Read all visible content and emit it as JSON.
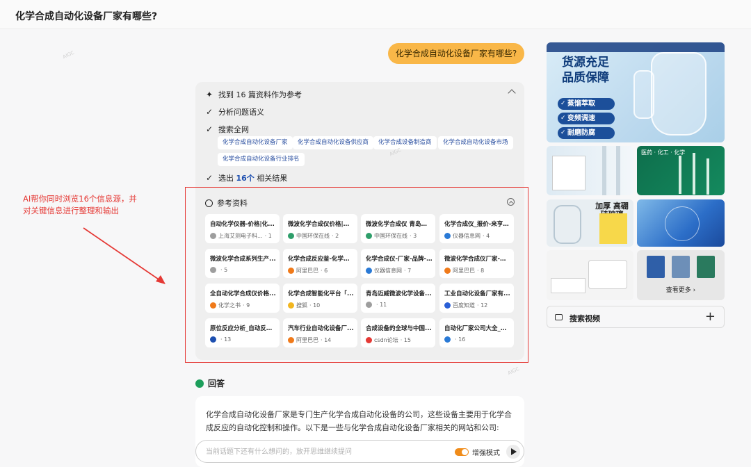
{
  "header": {
    "title": "化学合成自动化设备厂家有哪些?"
  },
  "query": {
    "text": "化学合成自动化设备厂家有哪些?"
  },
  "process": {
    "found": "找到 16 篇资料作为参考",
    "steps": [
      "分析问题语义",
      "搜索全网"
    ],
    "chips": [
      "化学合成自动化设备厂家",
      "化学合成自动化设备供应商",
      "化学合成设备制造商",
      "化学合成自动化设备市场",
      "化学合成自动化设备行业排名"
    ],
    "select_prefix": "选出",
    "select_count": "16个",
    "select_suffix": "相关结果"
  },
  "references": {
    "title": "参考资料",
    "cards": [
      {
        "title": "自动化学仪器-价格|化...",
        "source": "上海艾测电子科...",
        "num": "· 1",
        "color": "#9e9e9e"
      },
      {
        "title": "微波化学合成仪价格|报...",
        "source": "中国环保在线",
        "num": "· 2",
        "color": "#2e9e6a"
      },
      {
        "title": "微波化学合成仪 青岛东...",
        "source": "中国环保在线",
        "num": "· 3",
        "color": "#2e9e6a"
      },
      {
        "title": "化学合成仪_报价-来亨科...",
        "source": "仪器信息网",
        "num": "· 4",
        "color": "#2a7ad6"
      },
      {
        "title": "微波化学合成系列生产...",
        "source": "",
        "num": "· 5",
        "color": "#9e9e9e"
      },
      {
        "title": "化学合成反应釜-化学合...",
        "source": "阿里巴巴",
        "num": "· 6",
        "color": "#f07a1a"
      },
      {
        "title": "化学合成仪-厂家-品牌-...",
        "source": "仪器信息网",
        "num": "· 7",
        "color": "#2a7ad6"
      },
      {
        "title": "微波化学合成仪厂家-微...",
        "source": "阿里巴巴",
        "num": "· 8",
        "color": "#f07a1a"
      },
      {
        "title": "全自动化学合成仪价格...",
        "source": "化学之书",
        "num": "· 9",
        "color": "#f07a1a"
      },
      {
        "title": "化学合成智能化平台「...",
        "source": "搜狐",
        "num": "· 10",
        "color": "#f2b620"
      },
      {
        "title": "青岛迈威微波化学设备...",
        "source": "",
        "num": "· 11",
        "color": "#9e9e9e"
      },
      {
        "title": "工业自动化设备厂家有...",
        "source": "百度知道",
        "num": "· 12",
        "color": "#2a5fd6"
      },
      {
        "title": "原位反应分析_自动反应...",
        "source": "",
        "num": "· 13",
        "color": "#1d4fb0"
      },
      {
        "title": "汽车行业自动化设备厂...",
        "source": "阿里巴巴",
        "num": "· 14",
        "color": "#f07a1a"
      },
      {
        "title": "合成设备的全球与中国...",
        "source": "csdn论坛",
        "num": "· 15",
        "color": "#e53935"
      },
      {
        "title": "自动化厂家公司大全_自...",
        "source": "",
        "num": "· 16",
        "color": "#2a7ad6"
      }
    ]
  },
  "annotation": {
    "text": "AI帮你同时浏览16个信息源，并对关键信息进行整理和输出",
    "color": "#e53935"
  },
  "answer": {
    "title": "回答",
    "text": "化学合成自动化设备厂家是专门生产化学合成自动化设备的公司，这些设备主要用于化学合成反应的自动化控制和操作。以下是一些与化学合成自动化设备厂家相关的网站和公司:"
  },
  "input": {
    "placeholder": "当前话题下还有什么想问的，放开思维继续提问",
    "mode": "增强模式"
  },
  "images": {
    "main_lines": [
      "货源充足",
      "品质保障"
    ],
    "pills": [
      "蒸馏萃取",
      "变频调速",
      "耐磨防腐"
    ],
    "b_caption": "医药 · 化工 · 化学",
    "c_label": "加厚 高硼硅玻璃",
    "see_more": "查看更多 ›"
  },
  "video": {
    "label": "搜索视频"
  },
  "colors": {
    "accent": "#f9b748",
    "link": "#1d4fb0"
  }
}
